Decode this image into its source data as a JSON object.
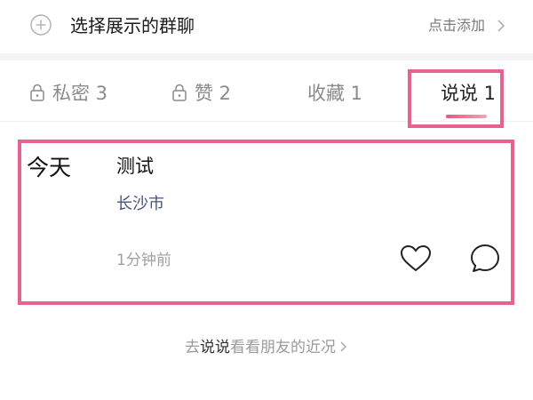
{
  "header": {
    "title": "选择展示的群聊",
    "action_label": "点击添加",
    "add_icon": "plus-circle-icon",
    "chevron_icon": "chevron-right-icon"
  },
  "tabs": [
    {
      "label": "私密 3",
      "locked": true
    },
    {
      "label": "赞 2",
      "locked": true
    },
    {
      "label": "收藏 1",
      "locked": false
    },
    {
      "label": "说说 1",
      "locked": false,
      "active": true
    }
  ],
  "post": {
    "day": "今天",
    "title": "测试",
    "location": "长沙市",
    "time_ago": "1分钟前",
    "like_icon": "heart-icon",
    "comment_icon": "comment-bubble-icon"
  },
  "footer": {
    "prefix": "去",
    "emphasis": "说说",
    "suffix": "看看朋友的近况"
  },
  "colors": {
    "highlight": "#e8628f",
    "location_text": "#46567a"
  }
}
